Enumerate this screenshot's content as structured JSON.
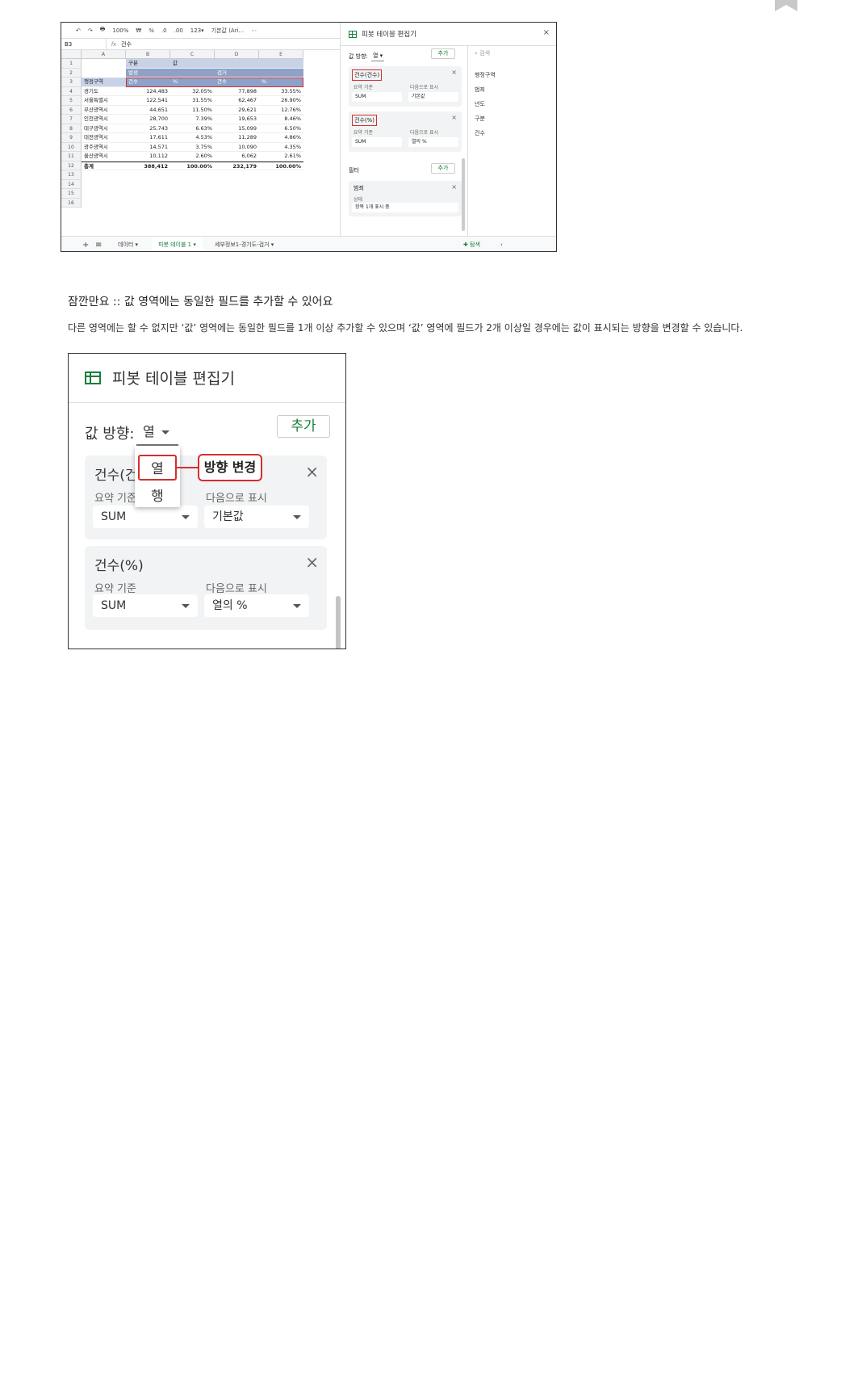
{
  "bookmark_icon": "bookmark-icon",
  "sheet": {
    "toolbar": [
      "↶",
      "↷",
      "🖶",
      "100%",
      "₩",
      "%",
      ".0",
      ".00",
      "123▾",
      "기본값 (Ari...",
      "⋯"
    ],
    "cell_ref": "B3",
    "formula": "건수",
    "col_headers": [
      "A",
      "B",
      "C",
      "D",
      "E"
    ],
    "row_numbers": [
      "1",
      "2",
      "3",
      "4",
      "5",
      "6",
      "7",
      "8",
      "9",
      "10",
      "11",
      "12",
      "13",
      "14",
      "15",
      "16"
    ],
    "header_row1": {
      "b": "구분",
      "c": "값"
    },
    "header_row2": {
      "b": "발생",
      "d": "검거"
    },
    "header_row3": {
      "a": "행정구역",
      "b": "건수",
      "c": "%",
      "d": "건수",
      "e": "%"
    },
    "rows": [
      {
        "name": "경기도",
        "v1": "124,483",
        "p1": "32.05%",
        "v2": "77,898",
        "p2": "33.55%"
      },
      {
        "name": "서울특별시",
        "v1": "122,541",
        "p1": "31.55%",
        "v2": "62,467",
        "p2": "26.90%"
      },
      {
        "name": "부산광역시",
        "v1": "44,651",
        "p1": "11.50%",
        "v2": "29,621",
        "p2": "12.76%"
      },
      {
        "name": "인천광역시",
        "v1": "28,700",
        "p1": "7.39%",
        "v2": "19,653",
        "p2": "8.46%"
      },
      {
        "name": "대구광역시",
        "v1": "25,743",
        "p1": "6.63%",
        "v2": "15,099",
        "p2": "6.50%"
      },
      {
        "name": "대전광역시",
        "v1": "17,611",
        "p1": "4.53%",
        "v2": "11,289",
        "p2": "4.86%"
      },
      {
        "name": "광주광역시",
        "v1": "14,571",
        "p1": "3.75%",
        "v2": "10,090",
        "p2": "4.35%"
      },
      {
        "name": "울산광역시",
        "v1": "10,112",
        "p1": "2.60%",
        "v2": "6,062",
        "p2": "2.61%"
      }
    ],
    "total": {
      "name": "총계",
      "v1": "388,412",
      "p1": "100.00%",
      "v2": "232,179",
      "p2": "100.00%"
    },
    "tabs": {
      "add": "+",
      "list": "≡",
      "tab1": "데이터 ▾",
      "tab2": "피봇 테이블 1 ▾",
      "tab3": "세부정보1-경기도-검거 ▾",
      "explore": "탐색",
      "collapse": "‹"
    }
  },
  "mini_pivot": {
    "title": "피봇 테이블 편집기",
    "close": "×",
    "direction_label": "값 방향:",
    "direction_value": "열 ▾",
    "add": "추가",
    "card1": {
      "title": "건수(건수)",
      "summ_label": "요약 기준",
      "summ_value": "SUM",
      "show_label": "다음으로 표시",
      "show_value": "기본값"
    },
    "card2": {
      "title": "건수(%)",
      "summ_label": "요약 기준",
      "summ_value": "SUM",
      "show_label": "다음으로 표시",
      "show_value": "열의 %"
    },
    "filter_label": "필터",
    "filter_add": "추가",
    "filter_card": {
      "title": "범죄",
      "status_label": "상태",
      "status_value": "항목 1개 표시 중"
    },
    "search_placeholder": "검색",
    "fields": [
      "행정구역",
      "범죄",
      "년도",
      "구분",
      "건수"
    ]
  },
  "heading": "잠깐만요 :: 값 영역에는 동일한 필드를 추가할 수 있어요",
  "paragraph": "다른 영역에는 할 수 없지만 ‘값’ 영역에는 동일한 필드를 1개 이상 추가할 수 있으며 ‘값’ 영역에 필드가 2개 이상일 경우에는 값이 표시되는 방향을 변경할 수 있습니다.",
  "zoom": {
    "title": "피봇 테이블 편집기",
    "direction_label": "값 방향:",
    "direction_value": "열",
    "add": "추가",
    "menu": [
      "열",
      "행"
    ],
    "callout": "방향 변경",
    "card1": {
      "title": "건수(건",
      "summ_label": "요약 기준",
      "summ_value": "SUM",
      "show_label": "다음으로 표시",
      "show_value": "기본값"
    },
    "card2": {
      "title": "건수(%)",
      "summ_label": "요약 기준",
      "summ_value": "SUM",
      "show_label": "다음으로 표시",
      "show_value": "열의 %"
    }
  },
  "colors": {
    "accent_green": "#188038",
    "highlight_red": "#d32f2f",
    "header_blue": "#8ea2c9"
  }
}
